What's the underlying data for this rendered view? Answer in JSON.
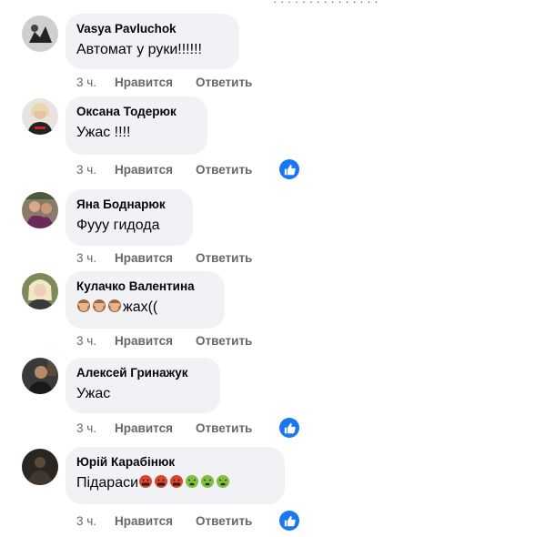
{
  "top_cut_text": "· · · · · · · ·   · · · · · · ·",
  "actions": {
    "like": "Нравится",
    "reply": "Ответить"
  },
  "comments": [
    {
      "author": "Vasya Pavluchok",
      "text": "Автомат у руки!!!!!!",
      "time": "3 ч.",
      "liked": false
    },
    {
      "author": "Оксана Тодерюк",
      "text": "Ужас !!!!",
      "time": "3 ч.",
      "liked": true
    },
    {
      "author": "Яна Боднарюк",
      "text": "Фууу гидода",
      "time": "3 ч.",
      "liked": false
    },
    {
      "author": "Кулачко Валентина",
      "text": "жах((",
      "emoji_before": [
        "see-no-evil-monkey",
        "see-no-evil-monkey",
        "see-no-evil-monkey"
      ],
      "time": "3 ч.",
      "liked": false
    },
    {
      "author": "Алексей Гринажук",
      "text": "Ужас",
      "time": "3 ч.",
      "liked": true
    },
    {
      "author": "Юрій Карабінюк",
      "text": "Підараси",
      "emoji_after": [
        "face-with-symbols-on-mouth",
        "face-with-symbols-on-mouth",
        "face-with-symbols-on-mouth",
        "nauseated-face",
        "nauseated-face",
        "nauseated-face"
      ],
      "time": "3 ч.",
      "liked": true
    }
  ],
  "colors": {
    "bubble": "#f0f2f5",
    "meta": "#65676b",
    "like_badge": "#1877f2"
  }
}
